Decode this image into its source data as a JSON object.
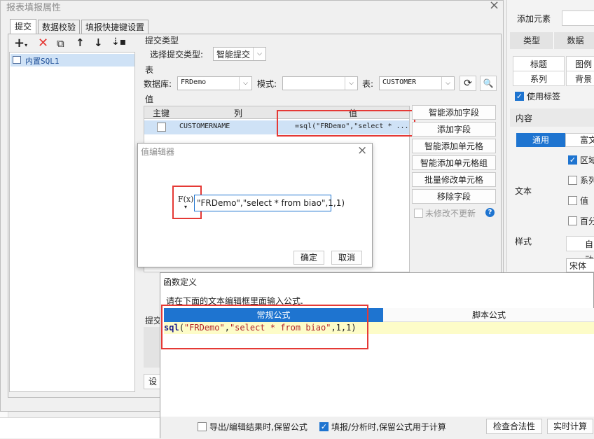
{
  "dialog": {
    "title": "报表填报属性",
    "close": "×",
    "tabs": [
      "提交",
      "数据校验",
      "填报快捷键设置"
    ],
    "tree": {
      "item": "内置SQL1"
    },
    "submit_type": {
      "section": "提交类型",
      "label": "选择提交类型:",
      "value": "智能提交"
    },
    "table": {
      "section": "表",
      "db_label": "数据库:",
      "db_value": "FRDemo",
      "schema_label": "模式:",
      "schema_value": "",
      "table_label": "表:",
      "table_value": "CUSTOMER"
    },
    "values": {
      "section": "值",
      "headers": [
        "主键",
        "列",
        "值"
      ],
      "rows": [
        {
          "key": false,
          "column": "CUSTOMERNAME",
          "value": "=sql(\"FRDemo\",\"select * ..."
        }
      ]
    },
    "side_buttons": [
      "智能添加字段",
      "添加字段",
      "智能添加单元格",
      "智能添加单元格组",
      "批量修改单元格",
      "移除字段"
    ],
    "no_modify": "未修改不更新",
    "bottom_label": "提交",
    "settings_button": "设"
  },
  "value_editor": {
    "title": "值编辑器",
    "close": "×",
    "fx": "F(x)",
    "input_value": "\"FRDemo\",\"select * from biao\",1,1)",
    "ok": "确定",
    "cancel": "取消"
  },
  "func_def": {
    "title": "函数定义",
    "hint": "请在下面的文本编辑框里面输入公式.",
    "tab_regular": "常规公式",
    "tab_script": "脚本公式",
    "formula_func": "sql",
    "formula_open": "(",
    "formula_arg1": "\"FRDemo\"",
    "formula_comma1": ",",
    "formula_arg2": "\"select * from biao\"",
    "formula_rest": ",1,1)",
    "export_keep": "导出/编辑结果时,保留公式",
    "fill_keep": "填报/分析时,保留公式用于计算",
    "check_button": "检查合法性",
    "realtime_button": "实时计算"
  },
  "right_panel": {
    "add_element": "添加元素",
    "tabs": [
      "类型",
      "数据"
    ],
    "row1": [
      "标题",
      "图例"
    ],
    "row2": [
      "系列",
      "背景"
    ],
    "use_label": "使用标签",
    "content": "内容",
    "sub_tabs": [
      "通用",
      "富文"
    ],
    "text": "文本",
    "opts": [
      "区域",
      "系列",
      "值",
      "百分"
    ],
    "style": "样式",
    "auto": "自动",
    "font": "宋体"
  },
  "colors": {
    "accent": "#1e74d0",
    "highlight_red": "#e53935",
    "selected_row": "#cfe2f6",
    "formula_bg": "#fdfcc8"
  }
}
